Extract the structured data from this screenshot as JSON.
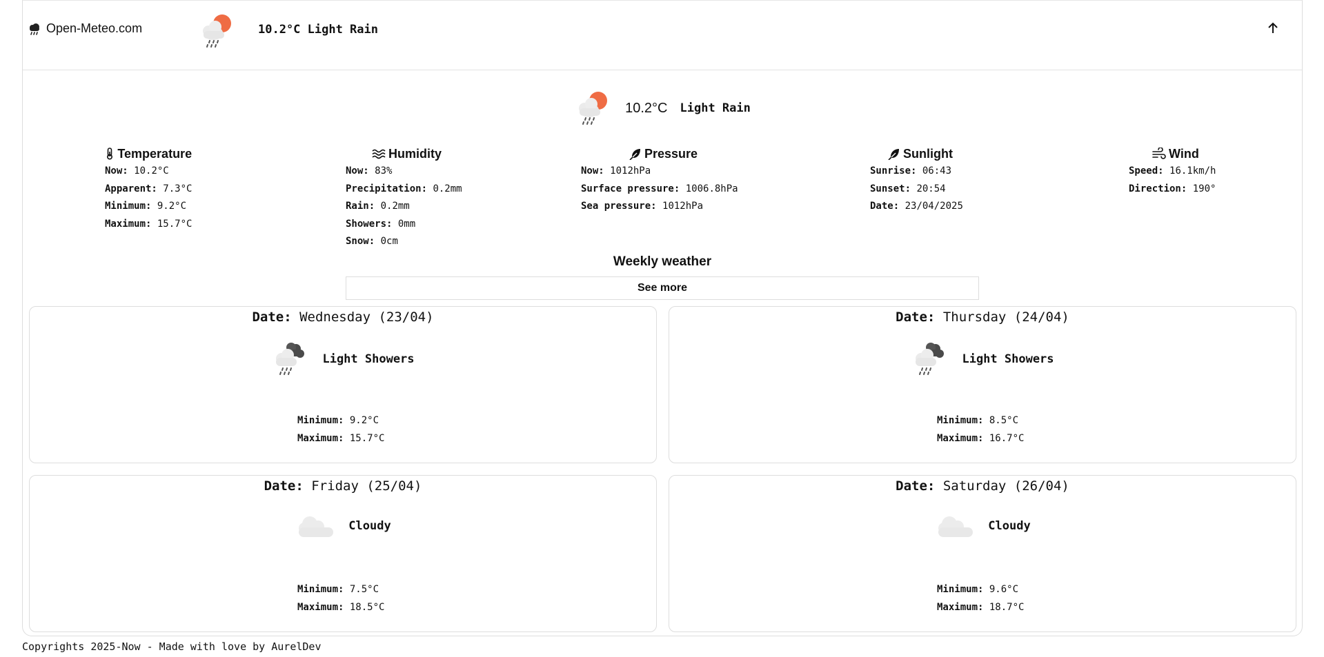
{
  "header": {
    "brand": "Open-Meteo.com",
    "brand_icon": "rain-cloud-icon",
    "summary": "10.2°C Light Rain",
    "scroll_icon": "arrow-up-icon"
  },
  "current": {
    "temperature": "10.2°C",
    "condition": "Light Rain",
    "icon": "partly-cloudy-rain-icon"
  },
  "stats": {
    "temperature": {
      "title": "Temperature",
      "icon": "thermometer-icon",
      "rows": [
        {
          "label": "Now:",
          "value": "10.2°C"
        },
        {
          "label": "Apparent:",
          "value": "7.3°C"
        },
        {
          "label": "Minimum:",
          "value": "9.2°C"
        },
        {
          "label": "Maximum:",
          "value": "15.7°C"
        }
      ]
    },
    "humidity": {
      "title": "Humidity",
      "icon": "waves-icon",
      "rows": [
        {
          "label": "Now:",
          "value": "83%"
        },
        {
          "label": "Precipitation:",
          "value": "0.2mm"
        },
        {
          "label": "Rain:",
          "value": "0.2mm"
        },
        {
          "label": "Showers:",
          "value": "0mm"
        },
        {
          "label": "Snow:",
          "value": "0cm"
        }
      ]
    },
    "pressure": {
      "title": "Pressure",
      "icon": "feather-icon",
      "rows": [
        {
          "label": "Now:",
          "value": "1012hPa"
        },
        {
          "label": "Surface pressure:",
          "value": "1006.8hPa"
        },
        {
          "label": "Sea pressure:",
          "value": "1012hPa"
        }
      ]
    },
    "sunlight": {
      "title": "Sunlight",
      "icon": "feather-icon",
      "rows": [
        {
          "label": "Sunrise:",
          "value": "06:43"
        },
        {
          "label": "Sunset:",
          "value": "20:54"
        },
        {
          "label": "Date:",
          "value": "23/04/2025"
        }
      ]
    },
    "wind": {
      "title": "Wind",
      "icon": "wind-icon",
      "rows": [
        {
          "label": "Speed:",
          "value": "16.1km/h"
        },
        {
          "label": "Direction:",
          "value": "190°"
        }
      ]
    }
  },
  "weekly": {
    "title": "Weekly weather",
    "see_more": "See more",
    "date_label": "Date:",
    "min_label": "Minimum:",
    "max_label": "Maximum:",
    "days": [
      {
        "date": "Wednesday (23/04)",
        "condition": "Light Showers",
        "icon": "dark-cloud-showers-icon",
        "min": "9.2°C",
        "max": "15.7°C"
      },
      {
        "date": "Thursday (24/04)",
        "condition": "Light Showers",
        "icon": "dark-cloud-showers-icon",
        "min": "8.5°C",
        "max": "16.7°C"
      },
      {
        "date": "Friday (25/04)",
        "condition": "Cloudy",
        "icon": "cloud-icon",
        "min": "7.5°C",
        "max": "18.5°C"
      },
      {
        "date": "Saturday (26/04)",
        "condition": "Cloudy",
        "icon": "cloud-icon",
        "min": "9.6°C",
        "max": "18.7°C"
      }
    ]
  },
  "footer": {
    "text": "Copyrights 2025-Now - Made with love by AurelDev"
  }
}
